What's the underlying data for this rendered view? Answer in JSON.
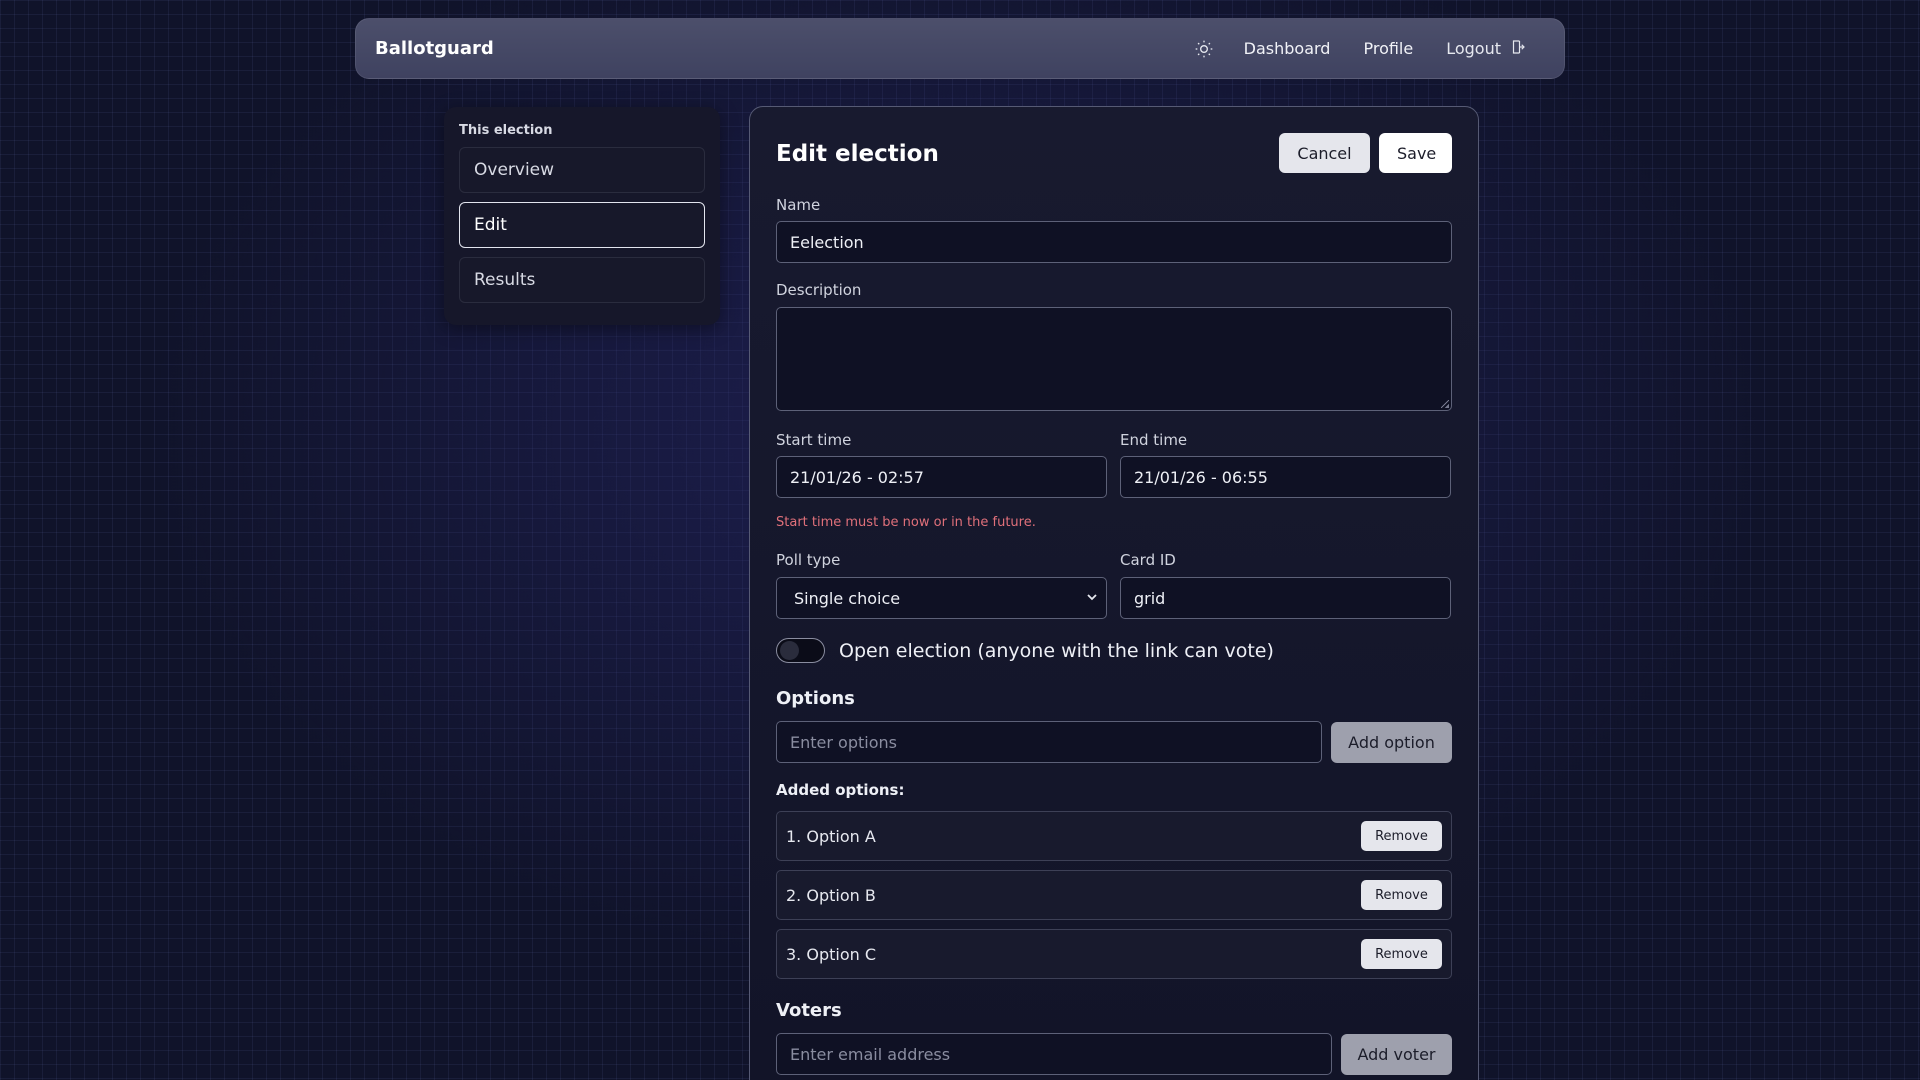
{
  "navbar": {
    "brand": "Ballotguard",
    "theme_icon": "sun-icon",
    "links": [
      "Dashboard",
      "Profile"
    ],
    "logout": "Logout",
    "logout_icon": "logout-icon"
  },
  "sidebar": {
    "title": "This election",
    "items": [
      "Overview",
      "Edit",
      "Results"
    ],
    "active": "Edit"
  },
  "form": {
    "title": "Edit election",
    "cancel": "Cancel",
    "save": "Save",
    "name_label": "Name",
    "name_value": "Eelection",
    "description_label": "Description",
    "description_value": "",
    "start_label": "Start time",
    "start_value": "21/01/26 - 02:57",
    "end_label": "End time",
    "end_value": "21/01/26 - 06:55",
    "start_error": "Start time must be now or in the future.",
    "poll_label": "Poll type",
    "poll_value": "Single choice",
    "card_label": "Card ID",
    "card_value": "grid",
    "open_label": "Open election (anyone with the link can vote)",
    "open_enabled": false,
    "options_title": "Options",
    "options_placeholder": "Enter options",
    "add_option": "Add option",
    "added_title": "Added options:",
    "options": [
      "1. Option A",
      "2. Option B",
      "3. Option C"
    ],
    "remove": "Remove",
    "voters_title": "Voters",
    "voters_placeholder": "Enter email address",
    "add_voter": "Add voter"
  },
  "colors": {
    "error": "#e0707a",
    "navbar": "#45486a",
    "background": "#10132a"
  }
}
